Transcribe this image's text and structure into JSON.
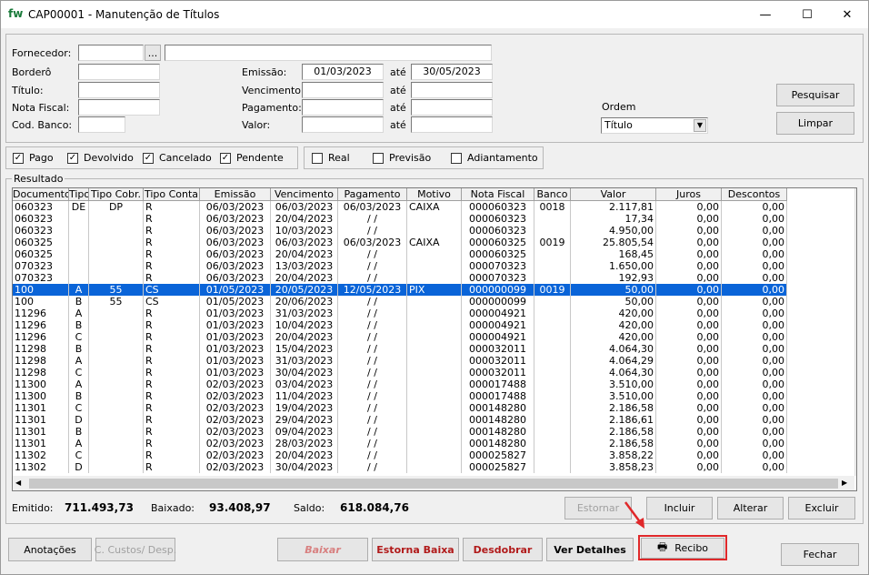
{
  "window": {
    "logo": "fw",
    "title": "CAP00001 - Manutenção de Títulos",
    "min": "—",
    "max": "☐",
    "close": "✕"
  },
  "filters": {
    "fornecedor_label": "Fornecedor:",
    "fornecedor_btn": "...",
    "bordero_label": "Borderô",
    "titulo_label": "Título:",
    "nota_label": "Nota Fiscal:",
    "banco_label": "Cod. Banco:",
    "emissao_label": "Emissão:",
    "emissao_de": "01/03/2023",
    "emissao_ate": "30/05/2023",
    "ate": "até",
    "vencimento_label": "Vencimento:",
    "pagamento_label": "Pagamento:",
    "valor_label": "Valor:",
    "ordem_label": "Ordem",
    "ordem_value": "Título",
    "pesquisar": "Pesquisar",
    "limpar": "Limpar"
  },
  "status_checks": [
    {
      "label": "Pago",
      "checked": true
    },
    {
      "label": "Devolvido",
      "checked": true
    },
    {
      "label": "Cancelado",
      "checked": true
    },
    {
      "label": "Pendente",
      "checked": true
    }
  ],
  "type_checks": [
    {
      "label": "Real",
      "checked": false
    },
    {
      "label": "Previsão",
      "checked": false
    },
    {
      "label": "Adiantamento",
      "checked": false
    }
  ],
  "results": {
    "legend": "Resultado",
    "columns": [
      "Documento",
      "Tipo",
      "Tipo Cobr.",
      "Tipo Conta",
      "Emissão",
      "Vencimento",
      "Pagamento",
      "Motivo",
      "Nota Fiscal",
      "Banco",
      "Valor",
      "Juros",
      "Descontos"
    ],
    "rows": [
      [
        "060323",
        "DE",
        "DP",
        "R",
        "06/03/2023",
        "06/03/2023",
        "06/03/2023",
        "CAIXA",
        "000060323",
        "0018",
        "2.117,81",
        "0,00",
        "0,00"
      ],
      [
        "060323",
        "",
        "",
        "R",
        "06/03/2023",
        "20/04/2023",
        " / /",
        "",
        "000060323",
        "",
        "17,34",
        "0,00",
        "0,00"
      ],
      [
        "060323",
        "",
        "",
        "R",
        "06/03/2023",
        "10/03/2023",
        " / /",
        "",
        "000060323",
        "",
        "4.950,00",
        "0,00",
        "0,00"
      ],
      [
        "060325",
        "",
        "",
        "R",
        "06/03/2023",
        "06/03/2023",
        "06/03/2023",
        "CAIXA",
        "000060325",
        "0019",
        "25.805,54",
        "0,00",
        "0,00"
      ],
      [
        "060325",
        "",
        "",
        "R",
        "06/03/2023",
        "20/04/2023",
        " / /",
        "",
        "000060325",
        "",
        "168,45",
        "0,00",
        "0,00"
      ],
      [
        "070323",
        "",
        "",
        "R",
        "06/03/2023",
        "13/03/2023",
        " / /",
        "",
        "000070323",
        "",
        "1.650,00",
        "0,00",
        "0,00"
      ],
      [
        "070323",
        "",
        "",
        "R",
        "06/03/2023",
        "20/04/2023",
        " / /",
        "",
        "000070323",
        "",
        "192,93",
        "0,00",
        "0,00"
      ],
      [
        "100",
        "A",
        "55",
        "CS",
        "01/05/2023",
        "20/05/2023",
        "12/05/2023",
        "PIX",
        "000000099",
        "0019",
        "50,00",
        "0,00",
        "0,00"
      ],
      [
        "100",
        "B",
        "55",
        "CS",
        "01/05/2023",
        "20/06/2023",
        " / /",
        "",
        "000000099",
        "",
        "50,00",
        "0,00",
        "0,00"
      ],
      [
        "11296",
        "A",
        "",
        "R",
        "01/03/2023",
        "31/03/2023",
        " / /",
        "",
        "000004921",
        "",
        "420,00",
        "0,00",
        "0,00"
      ],
      [
        "11296",
        "B",
        "",
        "R",
        "01/03/2023",
        "10/04/2023",
        " / /",
        "",
        "000004921",
        "",
        "420,00",
        "0,00",
        "0,00"
      ],
      [
        "11296",
        "C",
        "",
        "R",
        "01/03/2023",
        "20/04/2023",
        " / /",
        "",
        "000004921",
        "",
        "420,00",
        "0,00",
        "0,00"
      ],
      [
        "11298",
        "B",
        "",
        "R",
        "01/03/2023",
        "15/04/2023",
        " / /",
        "",
        "000032011",
        "",
        "4.064,30",
        "0,00",
        "0,00"
      ],
      [
        "11298",
        "A",
        "",
        "R",
        "01/03/2023",
        "31/03/2023",
        " / /",
        "",
        "000032011",
        "",
        "4.064,29",
        "0,00",
        "0,00"
      ],
      [
        "11298",
        "C",
        "",
        "R",
        "01/03/2023",
        "30/04/2023",
        " / /",
        "",
        "000032011",
        "",
        "4.064,30",
        "0,00",
        "0,00"
      ],
      [
        "11300",
        "A",
        "",
        "R",
        "02/03/2023",
        "03/04/2023",
        " / /",
        "",
        "000017488",
        "",
        "3.510,00",
        "0,00",
        "0,00"
      ],
      [
        "11300",
        "B",
        "",
        "R",
        "02/03/2023",
        "11/04/2023",
        " / /",
        "",
        "000017488",
        "",
        "3.510,00",
        "0,00",
        "0,00"
      ],
      [
        "11301",
        "C",
        "",
        "R",
        "02/03/2023",
        "19/04/2023",
        " / /",
        "",
        "000148280",
        "",
        "2.186,58",
        "0,00",
        "0,00"
      ],
      [
        "11301",
        "D",
        "",
        "R",
        "02/03/2023",
        "29/04/2023",
        " / /",
        "",
        "000148280",
        "",
        "2.186,61",
        "0,00",
        "0,00"
      ],
      [
        "11301",
        "B",
        "",
        "R",
        "02/03/2023",
        "09/04/2023",
        " / /",
        "",
        "000148280",
        "",
        "2.186,58",
        "0,00",
        "0,00"
      ],
      [
        "11301",
        "A",
        "",
        "R",
        "02/03/2023",
        "28/03/2023",
        " / /",
        "",
        "000148280",
        "",
        "2.186,58",
        "0,00",
        "0,00"
      ],
      [
        "11302",
        "C",
        "",
        "R",
        "02/03/2023",
        "20/04/2023",
        " / /",
        "",
        "000025827",
        "",
        "3.858,22",
        "0,00",
        "0,00"
      ],
      [
        "11302",
        "D",
        "",
        "R",
        "02/03/2023",
        "30/04/2023",
        " / /",
        "",
        "000025827",
        "",
        "3.858,23",
        "0,00",
        "0,00"
      ]
    ],
    "selected_index": 7
  },
  "totals": {
    "emitido_label": "Emitido:",
    "emitido": "711.493,73",
    "baixado_label": "Baixado:",
    "baixado": "93.408,97",
    "saldo_label": "Saldo:",
    "saldo": "618.084,76"
  },
  "actions": {
    "estornar": "Estornar",
    "incluir": "Incluir",
    "alterar": "Alterar",
    "excluir": "Excluir"
  },
  "bottom": {
    "anotacoes": "Anotações",
    "custos": "C. Custos/ Desp.",
    "baixar": "Baixar",
    "estorna_baixa": "Estorna Baixa",
    "desdobrar": "Desdobrar",
    "ver_detalhes": "Ver Detalhes",
    "recibo": "Recibo",
    "fechar": "Fechar"
  },
  "colors": {
    "selection": "#0a64d8",
    "highlight": "#e0282a",
    "logo": "#1a7a3a",
    "dark_red": "#b11a1a"
  }
}
